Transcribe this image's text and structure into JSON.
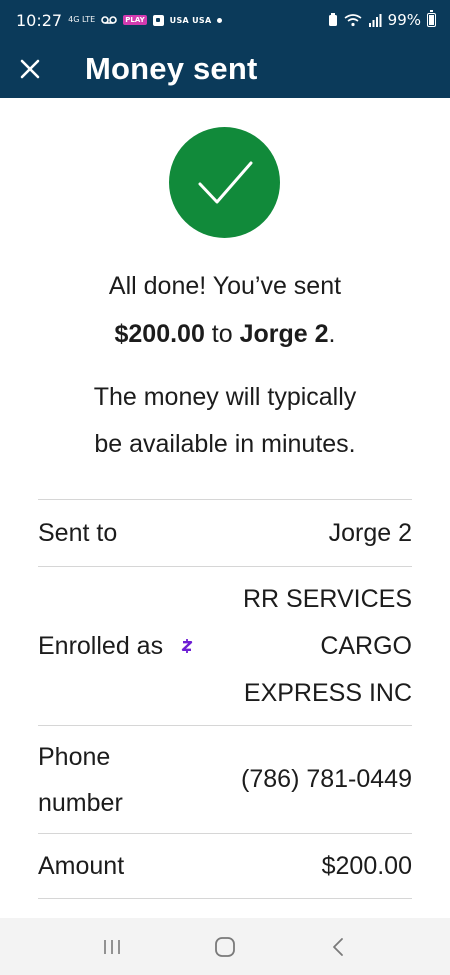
{
  "status_bar": {
    "time": "10:27",
    "small_label": "4G LTE",
    "chip": "PLAY",
    "usa_text": "USA USA",
    "battery_percent": "99%"
  },
  "header": {
    "title": "Money sent"
  },
  "success": {
    "line1": "All done! You’ve sent",
    "amount": "$200.00",
    "to_word": " to ",
    "recipient": "Jorge 2",
    "period": ".",
    "info_line1": "The money will typically",
    "info_line2": "be available in minutes."
  },
  "details": {
    "sent_to": {
      "label": "Sent to",
      "value": "Jorge 2"
    },
    "enrolled_as": {
      "label": "Enrolled as",
      "value_lines": [
        "RR SERVICES",
        "CARGO",
        "EXPRESS INC"
      ]
    },
    "phone": {
      "label_lines": [
        "Phone",
        "number"
      ],
      "value": "(786) 781-0449"
    },
    "amount": {
      "label": "Amount",
      "value": "$200.00"
    }
  },
  "colors": {
    "header_bg": "#0b3a5a",
    "success_green": "#118a3a",
    "zelle_purple": "#6d1ed4"
  },
  "icons": [
    "close-icon",
    "checkmark-icon",
    "zelle-icon",
    "recent-apps-icon",
    "home-icon",
    "back-icon"
  ]
}
